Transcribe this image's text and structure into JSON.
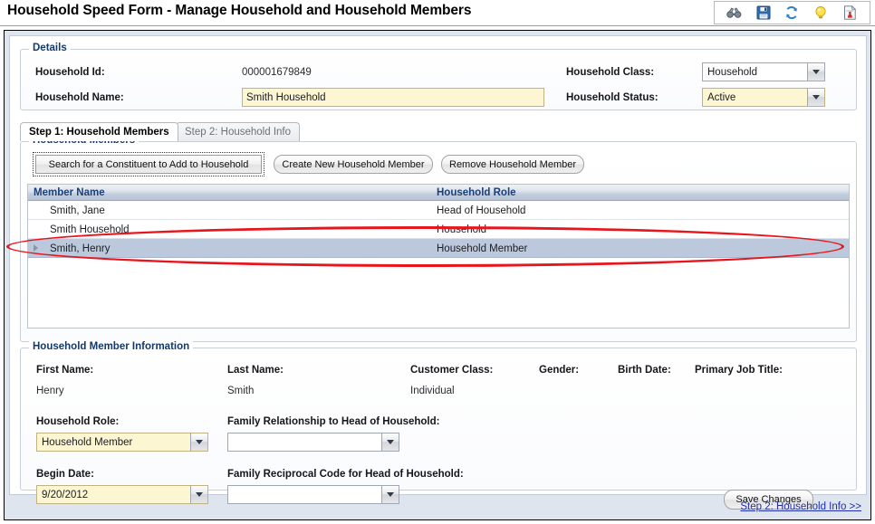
{
  "window": {
    "title": "Household Speed Form - Manage Household and Household Members"
  },
  "toolbar": {
    "icons": [
      {
        "name": "binoculars-icon",
        "label": "Find"
      },
      {
        "name": "save-icon",
        "label": "Save"
      },
      {
        "name": "refresh-icon",
        "label": "Refresh"
      },
      {
        "name": "lightbulb-icon",
        "label": "Hint"
      },
      {
        "name": "report-icon",
        "label": "Report"
      }
    ]
  },
  "details": {
    "legend": "Details",
    "household_id_label": "Household Id:",
    "household_id_value": "000001679849",
    "household_name_label": "Household Name:",
    "household_name_value": "Smith Household",
    "household_class_label": "Household Class:",
    "household_class_value": "Household",
    "household_status_label": "Household Status:",
    "household_status_value": "Active"
  },
  "tabs": [
    {
      "label": "Step 1: Household Members",
      "active": true
    },
    {
      "label": "Step 2: Household Info",
      "active": false
    }
  ],
  "members_section": {
    "legend": "Household Members",
    "buttons": {
      "search_constituent": "Search for a Constituent to Add to Household",
      "create_member": "Create New Household Member",
      "remove_member": "Remove Household Member"
    },
    "grid": {
      "columns": [
        "Member Name",
        "Household Role"
      ],
      "rows": [
        {
          "member_name": "Smith, Jane",
          "household_role": "Head of Household",
          "selected": false
        },
        {
          "member_name": "Smith Household",
          "household_role": "Household",
          "selected": false
        },
        {
          "member_name": "Smith, Henry",
          "household_role": "Household Member",
          "selected": true
        }
      ]
    }
  },
  "member_info": {
    "legend": "Household Member Information",
    "first_name_label": "First Name:",
    "first_name_value": "Henry",
    "last_name_label": "Last Name:",
    "last_name_value": "Smith",
    "customer_class_label": "Customer Class:",
    "customer_class_value": "Individual",
    "gender_label": "Gender:",
    "gender_value": "",
    "birth_date_label": "Birth Date:",
    "birth_date_value": "",
    "primary_job_title_label": "Primary Job Title:",
    "primary_job_title_value": "",
    "household_role_label": "Household Role:",
    "household_role_value": "Household Member",
    "family_relationship_label": "Family Relationship to Head of Household:",
    "family_relationship_value": "",
    "begin_date_label": "Begin Date:",
    "begin_date_value": "9/20/2012",
    "family_reciprocal_label": "Family Reciprocal Code for Head of Household:",
    "family_reciprocal_value": "",
    "save_changes_label": "Save Changes"
  },
  "footer": {
    "next_step_link": "Step 2: Household Info >>"
  },
  "colors": {
    "required_field_bg": "#fdf6d3",
    "grid_selected_bg": "#bcc9dc",
    "grid_header_text": "#1b3f78",
    "legend_text": "#13386b",
    "link_text": "#1f2eb0",
    "annotation": "#e8151c"
  }
}
